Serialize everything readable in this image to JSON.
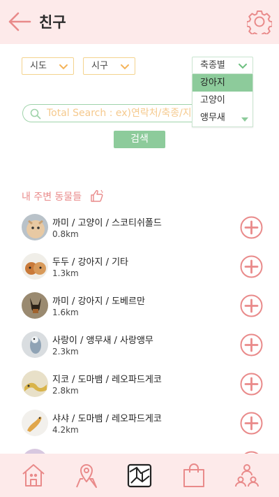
{
  "header": {
    "title": "친구",
    "back_icon": "arrow-left-icon",
    "settings_icon": "gear-icon"
  },
  "filters": {
    "sido": "시도",
    "sigu": "시구",
    "species": "축종별",
    "species_options": [
      "강아지",
      "고양이",
      "앵무새"
    ],
    "selected_option": "강아지"
  },
  "search": {
    "placeholder": "Total Search : ex)연락처/축종/지역",
    "button": "검색"
  },
  "section_title": "내 주변 동물들",
  "friends": [
    {
      "name": "까미 / 고양이 / 스코티쉬폴드",
      "distance": "0.8km"
    },
    {
      "name": "두두 / 강아지 / 기타",
      "distance": "1.3km"
    },
    {
      "name": "까미 / 강아지 / 도베르만",
      "distance": "1.6km"
    },
    {
      "name": "사랑이 / 앵무새 / 사랑앵무",
      "distance": "2.3km"
    },
    {
      "name": "지코 / 도마뱀 / 레오파드게코",
      "distance": "2.8km"
    },
    {
      "name": "샤샤 / 도마뱀 / 레오파드게코",
      "distance": "4.2km"
    }
  ],
  "colors": {
    "header_bg": "#fdeaea",
    "accent_pink": "#e98a8a",
    "accent_green": "#8dcb9b",
    "accent_orange": "#f5c98d"
  },
  "bottom_nav": [
    "home-icon",
    "map-pin-icon",
    "map-icon",
    "shopping-bag-icon",
    "friends-icon"
  ]
}
